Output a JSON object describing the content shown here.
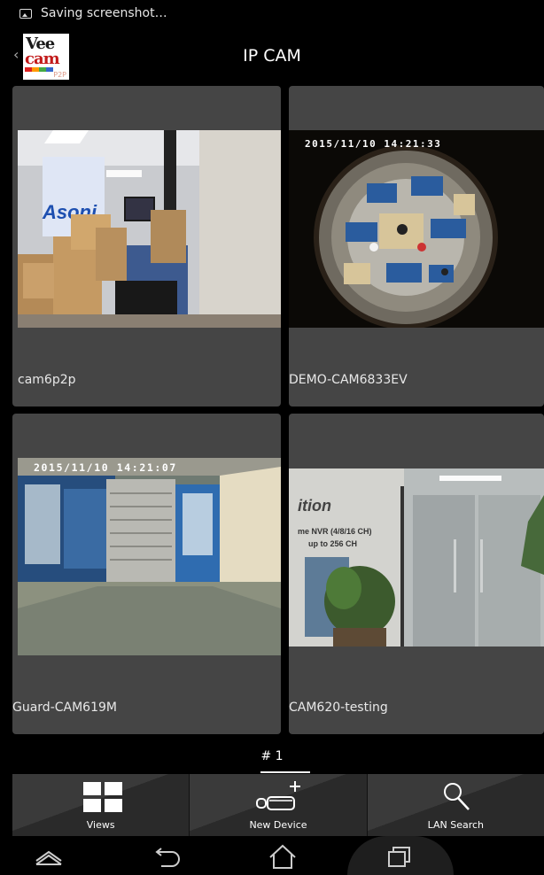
{
  "status_bar": {
    "notification": "Saving screenshot…"
  },
  "header": {
    "title": "IP CAM",
    "logo": {
      "line1": "Vee",
      "line2": "cam",
      "sub": "P2P"
    }
  },
  "cameras": [
    {
      "name": "cam6p2p",
      "timestamp": ""
    },
    {
      "name": "DEMO-CAM6833EV",
      "timestamp": "2015/11/10 14:21:33"
    },
    {
      "name": "Guard-CAM619M",
      "timestamp": "2015/11/10 14:21:07"
    },
    {
      "name": "CAM620-testing",
      "timestamp": ""
    }
  ],
  "scene_text": {
    "cam1_sign": "Asoni",
    "cam4_sign": "ition",
    "cam4_nvr": "me NVR (4/8/16 CH)",
    "cam4_sub": "up to 256 CH"
  },
  "pager": {
    "label": "# 1"
  },
  "toolbar": {
    "views": "Views",
    "new_device": "New Device",
    "lan_search": "LAN Search"
  },
  "icons": [
    "image-icon",
    "back-chevron-icon",
    "grid-icon",
    "camera-add-icon",
    "search-icon",
    "nav-home-icon",
    "nav-back-icon",
    "nav-recents-icon",
    "nav-up-icon"
  ]
}
